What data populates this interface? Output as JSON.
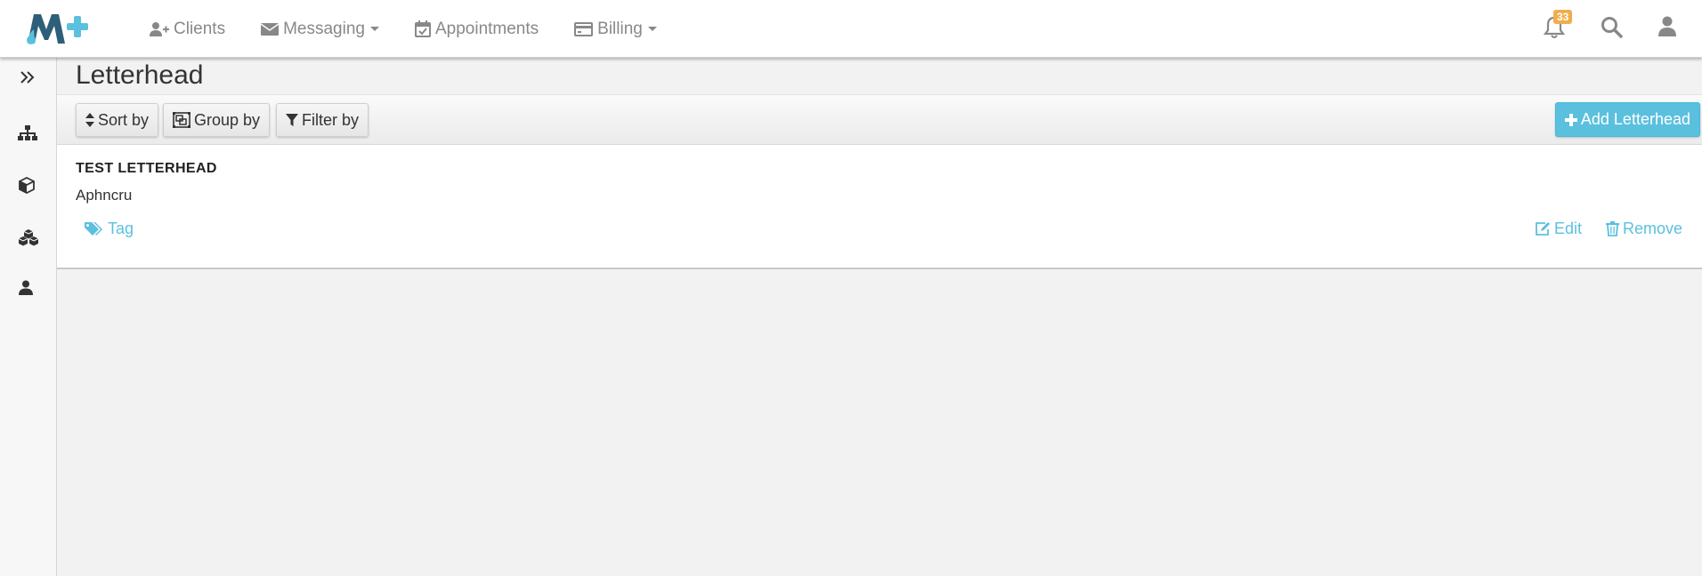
{
  "app": {
    "logo_alt": "M+",
    "brand_colors": {
      "dark": "#2e5f7a",
      "accent": "#5bc0de"
    }
  },
  "nav": {
    "items": [
      {
        "label": "Clients",
        "icon": "user-plus-icon",
        "dropdown": false
      },
      {
        "label": "Messaging",
        "icon": "envelope-icon",
        "dropdown": true
      },
      {
        "label": "Appointments",
        "icon": "calendar-check-icon",
        "dropdown": false
      },
      {
        "label": "Billing",
        "icon": "credit-card-icon",
        "dropdown": true
      }
    ],
    "notification_count": "33"
  },
  "sidebar": {
    "icons": [
      "expand-icon",
      "sitemap-icon",
      "cube-icon",
      "cubes-icon",
      "user-icon"
    ]
  },
  "page": {
    "title": "Letterhead"
  },
  "toolbar": {
    "sort_label": "Sort by",
    "group_label": "Group by",
    "filter_label": "Filter by",
    "add_label": "Add Letterhead"
  },
  "items": [
    {
      "title": "TEST LETTERHEAD",
      "subtitle": "Aphncru",
      "tag_label": "Tag",
      "edit_label": "Edit",
      "remove_label": "Remove"
    }
  ]
}
